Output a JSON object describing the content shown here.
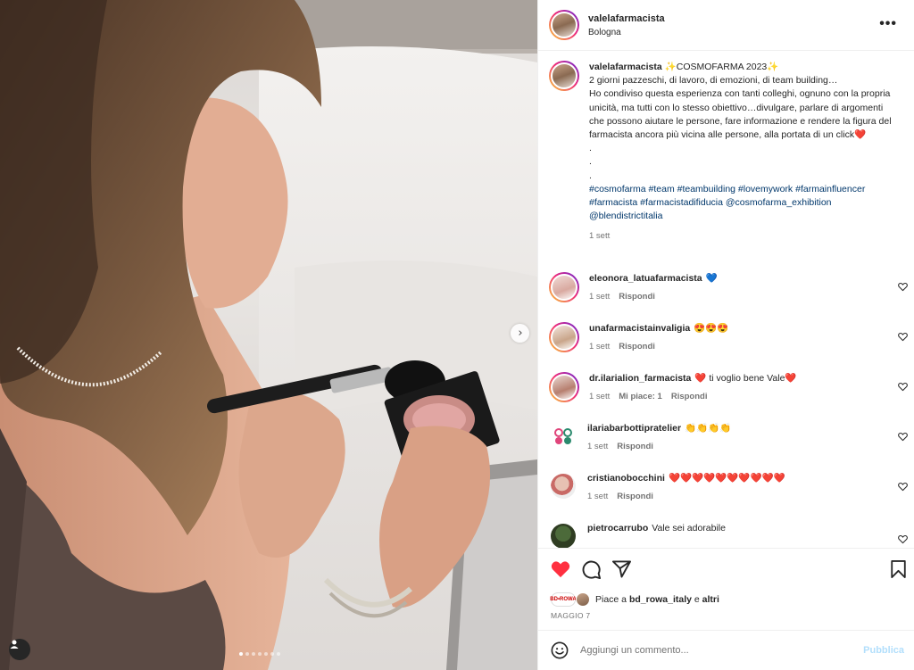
{
  "post": {
    "username": "valelafarmacista",
    "location": "Bologna",
    "more_label": "•••"
  },
  "caption": {
    "username": "valelafarmacista",
    "lines": [
      "✨COSMOFARMA 2023✨",
      "2 giorni pazzeschi, di lavoro, di emozioni, di team building…",
      "Ho condiviso questa esperienza con tanti colleghi, ognuno con la propria unicità, ma tutti con lo stesso obiettivo…divulgare, parlare di argomenti che possono aiutare le persone, fare informazione e rendere la figura del farmacista ancora più vicina alle persone, alla portata di un click❤️",
      ".",
      ".",
      "."
    ],
    "hashtags": "#cosmofarma #team #teambuilding #lovemywork #farmainfluencer #farmacista #farmacistadifiducia @cosmofarma_exhibition @blendistrictitalia",
    "time": "1 sett"
  },
  "comments": [
    {
      "username": "eleonora_latuafarmacista",
      "text": "💙",
      "time": "1 sett",
      "likes": "",
      "reply": "Rispondi"
    },
    {
      "username": "unafarmacistainvaligia",
      "text": "😍😍😍",
      "time": "1 sett",
      "likes": "",
      "reply": "Rispondi"
    },
    {
      "username": "dr.ilarialion_farmacista",
      "text": "❤️ ti voglio bene Vale❤️",
      "time": "1 sett",
      "likes": "Mi piace: 1",
      "reply": "Rispondi"
    },
    {
      "username": "ilariabarbottipratelier",
      "text": "👏👏👏👏",
      "time": "1 sett",
      "likes": "",
      "reply": "Rispondi"
    },
    {
      "username": "cristianobocchini",
      "text": "❤️❤️❤️❤️❤️❤️❤️❤️❤️❤️",
      "time": "1 sett",
      "likes": "",
      "reply": "Rispondi"
    },
    {
      "username": "pietrocarrubo",
      "text": "Vale sei adorabile",
      "time": "",
      "likes": "",
      "reply": ""
    }
  ],
  "likes": {
    "prefix": "Piace a",
    "user": "bd_rowa_italy",
    "suffix": "e",
    "others": "altri",
    "badge": "BD•ROWA"
  },
  "date": "MAGGIO 7",
  "add_comment": {
    "placeholder": "Aggiungi un commento...",
    "publish": "Pubblica"
  },
  "carousel": {
    "count": 7,
    "active": 1
  },
  "icons": {
    "like": "heart-filled-icon",
    "comment": "comment-bubble-icon",
    "share": "share-paper-plane-icon",
    "save": "bookmark-icon",
    "emoji": "smiley-icon",
    "next": "chevron-right-icon",
    "user_tag": "person-icon"
  },
  "colors": {
    "like_red": "#ff3040",
    "link_blue": "#00376b",
    "publish_disabled": "#b2dffc",
    "muted": "#737373"
  }
}
